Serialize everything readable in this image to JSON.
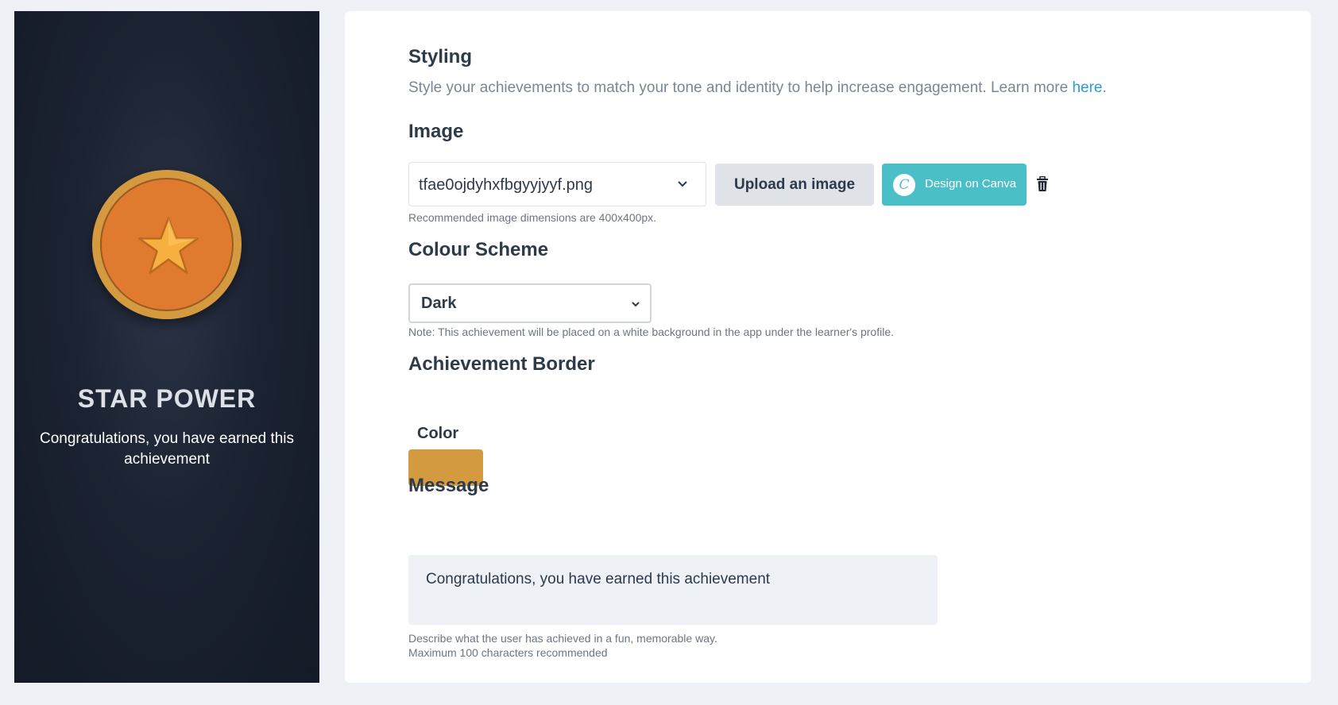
{
  "preview": {
    "title": "STAR POWER",
    "message": "Congratulations, you have earned this achievement",
    "badge_icon": "star-icon",
    "badge_colors": {
      "border": "#d49a3f",
      "fill": "#e07a2f",
      "star": "#f6b040"
    }
  },
  "styling": {
    "heading": "Styling",
    "description": "Style your achievements to match your tone and identity to help increase engagement. Learn more ",
    "link_text": "here",
    "link_suffix": "."
  },
  "image": {
    "heading": "Image",
    "selected_file": "tfae0ojdyhxfbgyyjyyf.png",
    "upload_label": "Upload an image",
    "canva_label": "Design on Canva",
    "canva_icon": "C",
    "hint": "Recommended image dimensions are 400x400px."
  },
  "colour_scheme": {
    "heading": "Colour Scheme",
    "selected": "Dark",
    "note": "Note: This achievement will be placed on a white background in the app under the learner's profile."
  },
  "border": {
    "heading": "Achievement Border",
    "color_label": "Color",
    "color_value": "#d49a3f"
  },
  "message": {
    "heading": "Message",
    "value": "Congratulations, you have earned this achievement",
    "hint_line1": "Describe what the user has achieved in a fun, memorable way.",
    "hint_line2": "Maximum 100 characters recommended"
  }
}
